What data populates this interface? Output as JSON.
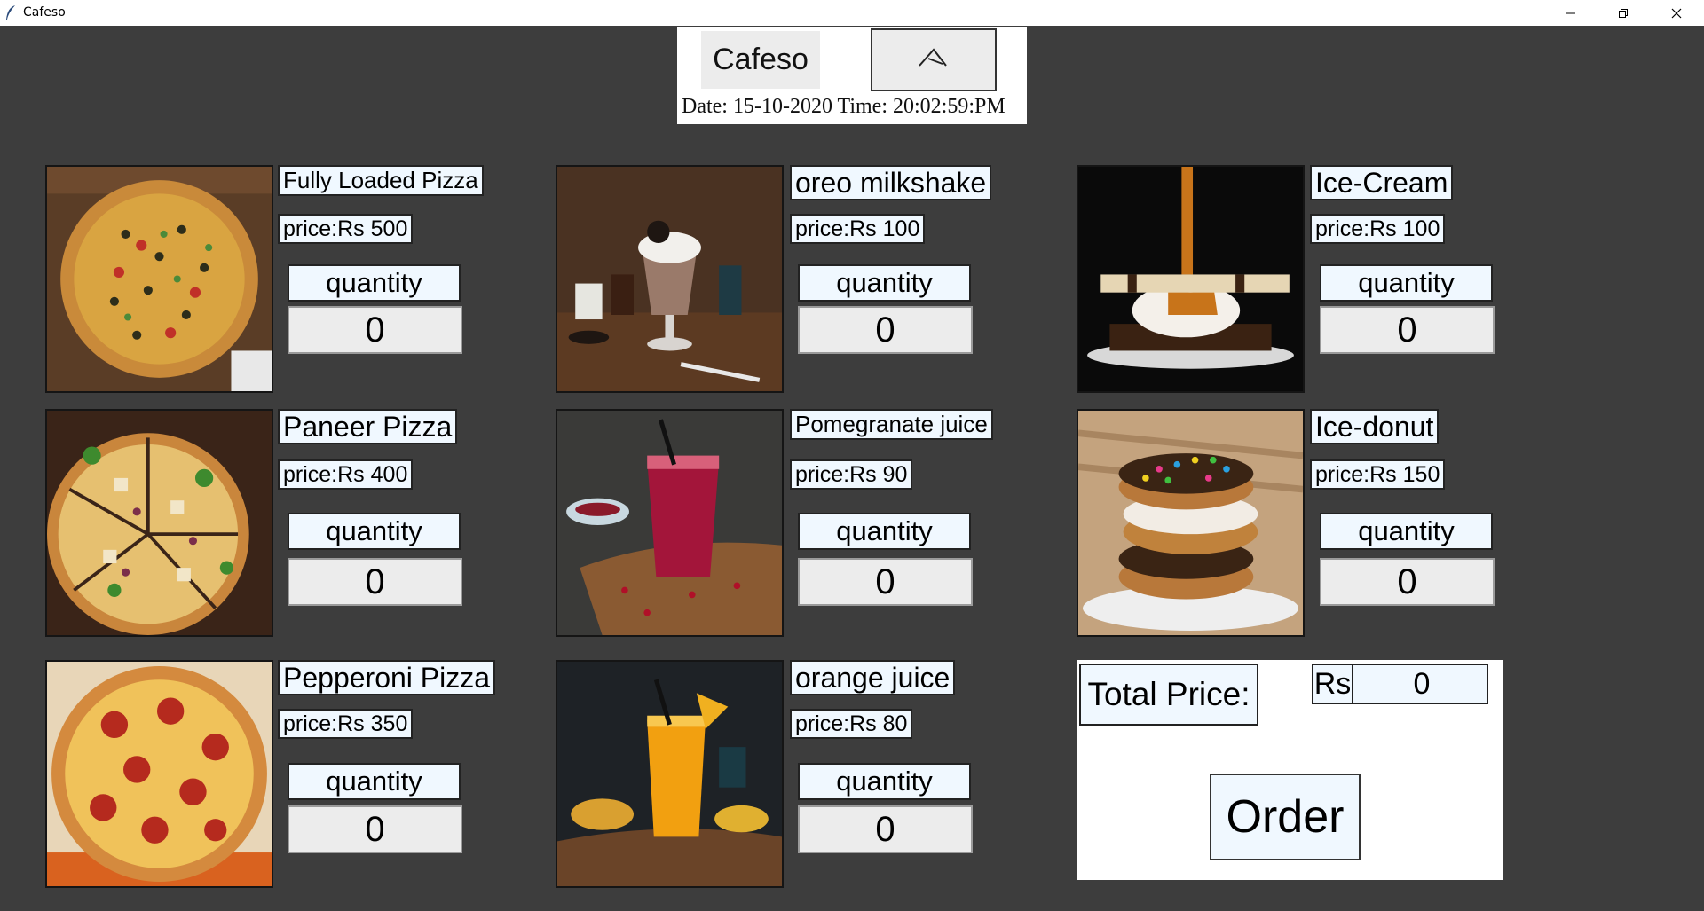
{
  "window": {
    "title": "Cafeso",
    "icons": [
      "feather-icon",
      "minimize-icon",
      "restore-icon",
      "close-icon"
    ]
  },
  "header": {
    "brand": "Cafeso",
    "datetime": "Date: 15-10-2020 Time: 20:02:59:PM"
  },
  "items": [
    {
      "name": "Fully Loaded Pizza",
      "price": "price:Rs 500",
      "qty_label": "quantity",
      "qty": "0"
    },
    {
      "name": "oreo milkshake",
      "price": "price:Rs 100",
      "qty_label": "quantity",
      "qty": "0"
    },
    {
      "name": "Ice-Cream",
      "price": "price:Rs 100",
      "qty_label": "quantity",
      "qty": "0"
    },
    {
      "name": "Paneer Pizza",
      "price": "price:Rs 400",
      "qty_label": "quantity",
      "qty": "0"
    },
    {
      "name": "Pomegranate juice",
      "price": "price:Rs 90",
      "qty_label": "quantity",
      "qty": "0"
    },
    {
      "name": "Ice-donut",
      "price": "price:Rs 150",
      "qty_label": "quantity",
      "qty": "0"
    },
    {
      "name": "Pepperoni Pizza",
      "price": "price:Rs 350",
      "qty_label": "quantity",
      "qty": "0"
    },
    {
      "name": "orange juice",
      "price": "price:Rs 80",
      "qty_label": "quantity",
      "qty": "0"
    }
  ],
  "total": {
    "label": "Total Price:",
    "currency": "Rs",
    "value": "0"
  },
  "order_label": "Order",
  "colors": {
    "background": "#3d3d3d",
    "label_bg": "#f0f8ff",
    "panel_bg": "#ffffff"
  }
}
